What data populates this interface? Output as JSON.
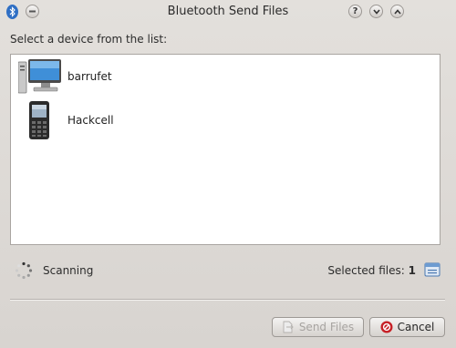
{
  "window": {
    "title": "Bluetooth Send Files",
    "controls": [
      {
        "name": "help",
        "glyph": "?"
      },
      {
        "name": "minimize",
        "glyph": "⌄"
      },
      {
        "name": "maximize",
        "glyph": "⌃"
      }
    ]
  },
  "prompt": "Select a device from the list:",
  "devices": [
    {
      "name": "barrufet",
      "icon": "computer-icon"
    },
    {
      "name": "Hackcell",
      "icon": "phone-icon"
    }
  ],
  "status": {
    "scanning_label": "Scanning",
    "selected_files_label": "Selected files:",
    "selected_files_count": "1"
  },
  "buttons": {
    "send_label": "Send Files",
    "send_enabled": false,
    "cancel_label": "Cancel"
  },
  "colors": {
    "window_bg": "#d9d5d1",
    "list_bg": "#ffffff",
    "bluetooth_blue": "#2f6fc4",
    "cancel_red": "#c62026",
    "disabled_text": "#a7a4a1"
  }
}
